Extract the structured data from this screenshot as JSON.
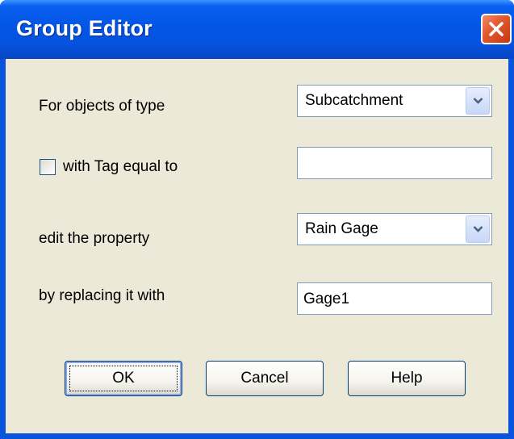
{
  "window": {
    "title": "Group Editor"
  },
  "form": {
    "object_type_label": "For objects of type",
    "object_type_value": "Subcatchment",
    "tag_checkbox_label": "with Tag equal to",
    "tag_checked": false,
    "tag_value": "",
    "property_label": "edit the property",
    "property_value": "Rain Gage",
    "replace_label": "by replacing it with",
    "replace_value": "Gage1"
  },
  "buttons": {
    "ok": "OK",
    "cancel": "Cancel",
    "help": "Help"
  },
  "icons": {
    "close": "close-icon",
    "dropdown": "chevron-down-icon"
  },
  "colors": {
    "titlebar": "#0553df",
    "client": "#ece9d8",
    "close": "#e35a31"
  }
}
